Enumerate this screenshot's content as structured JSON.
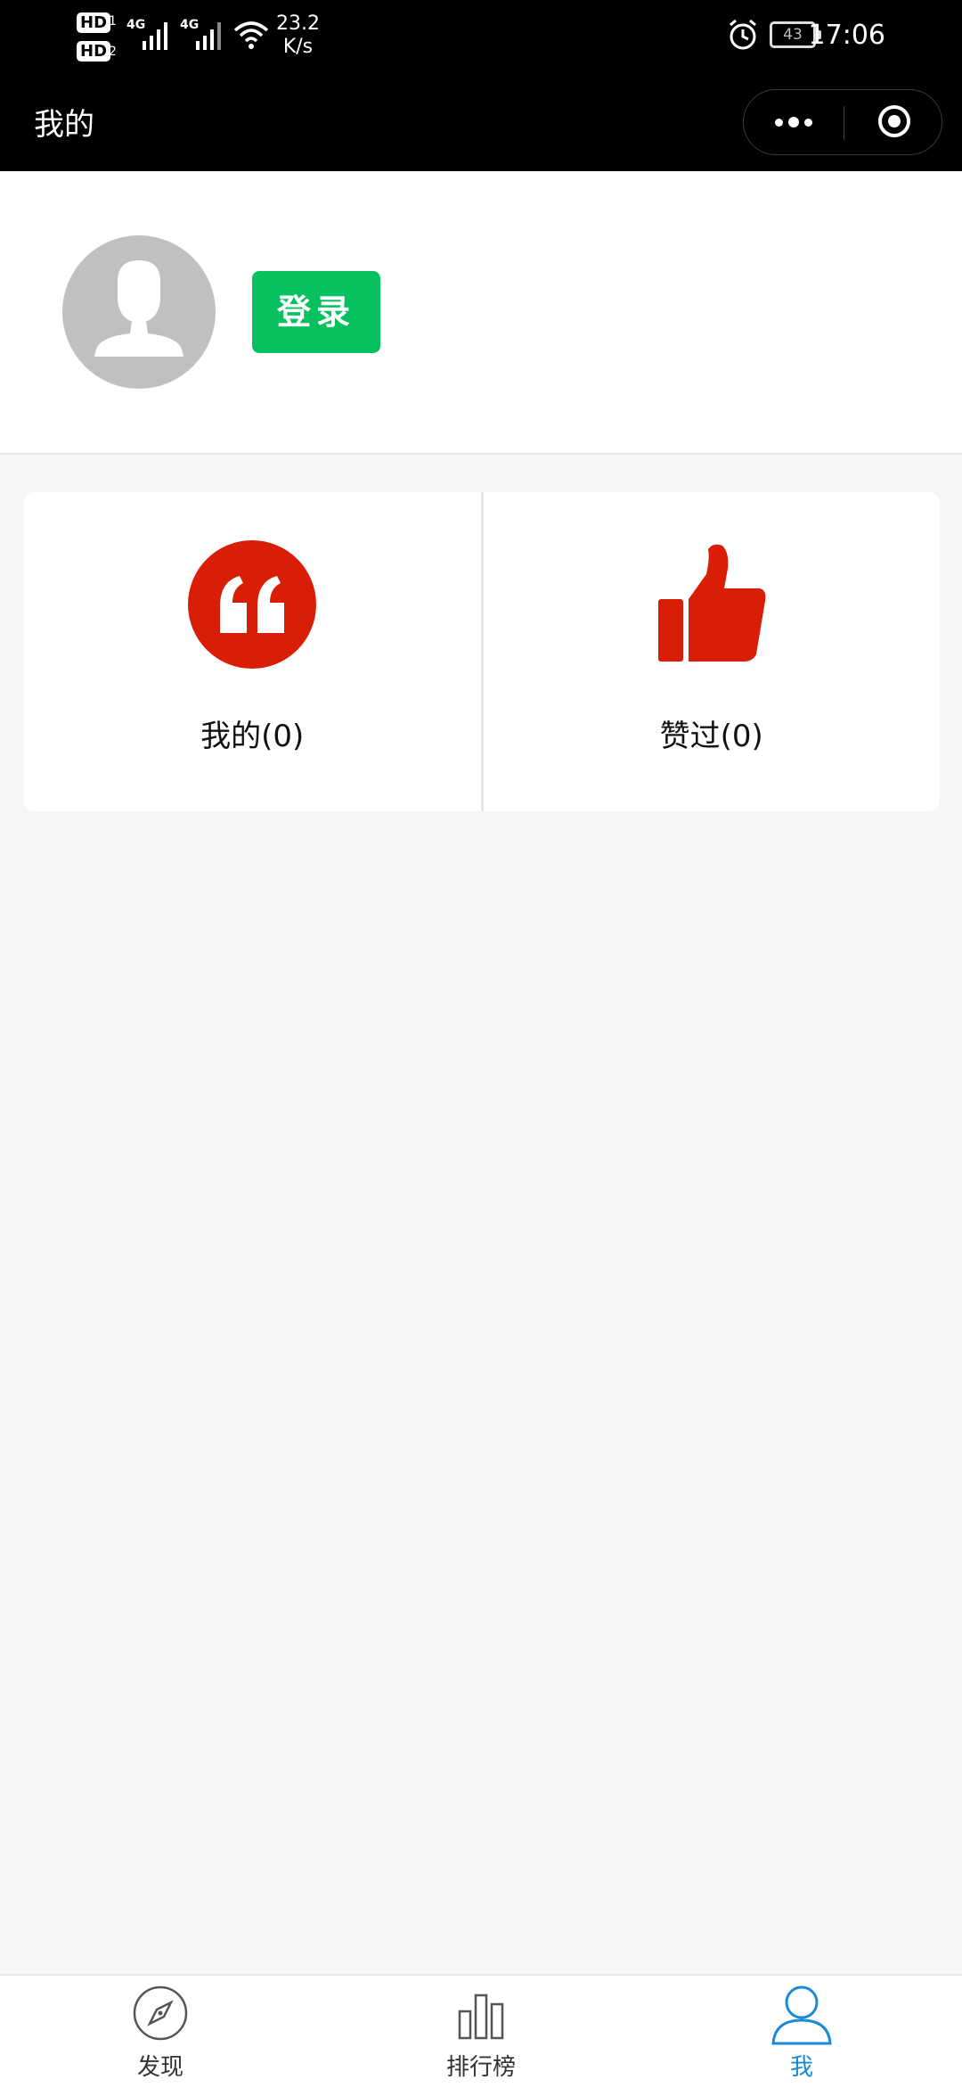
{
  "status_bar": {
    "hd1": "HD",
    "hd1_num": "1",
    "hd2": "HD",
    "hd2_num": "2",
    "net1": "4G",
    "net2": "4G",
    "speed_value": "23.2",
    "speed_unit": "K/s",
    "battery": "43",
    "time": "17:06"
  },
  "header": {
    "title": "我的"
  },
  "profile": {
    "login_label": "登录"
  },
  "cards": [
    {
      "label": "我的(0)",
      "icon": "quote-icon",
      "color": "#d81e06"
    },
    {
      "label": "赞过(0)",
      "icon": "thumbs-up-icon",
      "color": "#d81e06"
    }
  ],
  "tabbar": {
    "items": [
      {
        "label": "发现",
        "icon": "compass-icon",
        "active": false
      },
      {
        "label": "排行榜",
        "icon": "bar-chart-icon",
        "active": false
      },
      {
        "label": "我",
        "icon": "user-icon",
        "active": true
      }
    ],
    "active_color": "#1a8ad8"
  },
  "colors": {
    "login_green": "#07c160",
    "background": "#f6f6f6"
  }
}
